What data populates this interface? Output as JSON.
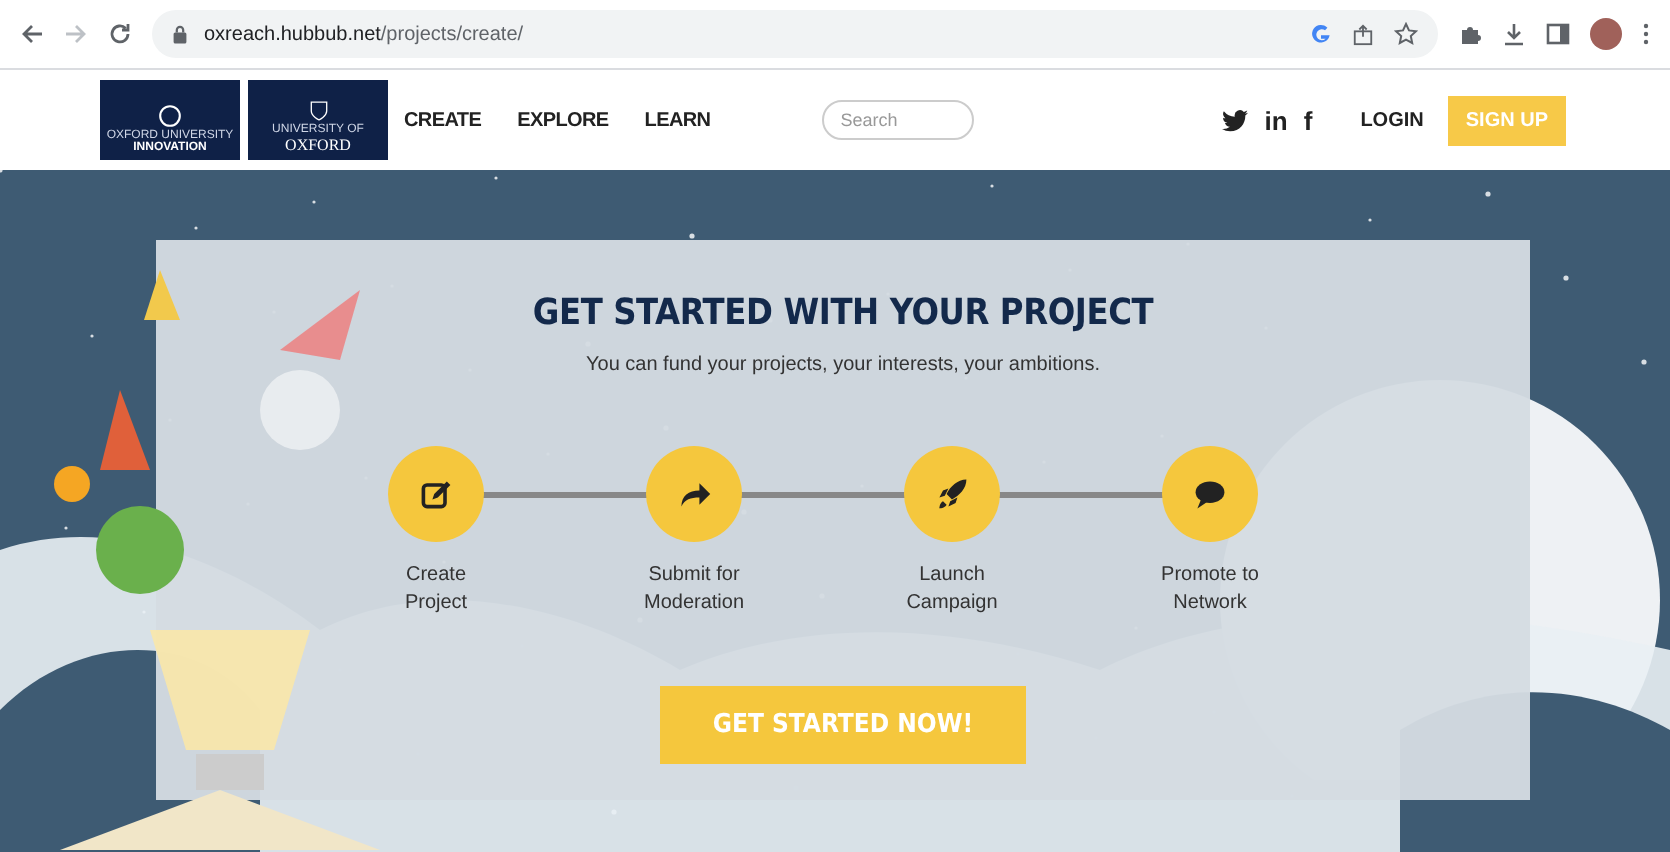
{
  "browser": {
    "url_domain": "oxreach.hubbub.net",
    "url_path": "/projects/create/"
  },
  "header": {
    "logos": [
      {
        "top": "OXFORD UNIVERSITY",
        "bottom": "INNOVATION"
      },
      {
        "top": "UNIVERSITY OF",
        "bottom": "OXFORD"
      }
    ],
    "nav": [
      {
        "label": "CREATE"
      },
      {
        "label": "EXPLORE"
      },
      {
        "label": "LEARN"
      }
    ],
    "search": {
      "placeholder": "Search"
    },
    "social": [
      {
        "kind": "twitter"
      },
      {
        "kind": "text",
        "label": "in"
      },
      {
        "kind": "text",
        "label": "f"
      }
    ],
    "login": "LOGIN",
    "signup": "SIGN UP"
  },
  "hero": {
    "title": "GET STARTED WITH YOUR PROJECT",
    "subtitle": "You can fund your projects, your interests, your ambitions.",
    "steps": [
      {
        "kind": "edit",
        "label": "Create\nProject"
      },
      {
        "kind": "share",
        "label": "Submit for\nModeration"
      },
      {
        "kind": "rocket",
        "label": "Launch\nCampaign"
      },
      {
        "kind": "comment",
        "label": "Promote to\nNetwork"
      }
    ],
    "cta": "GET STARTED NOW!"
  }
}
